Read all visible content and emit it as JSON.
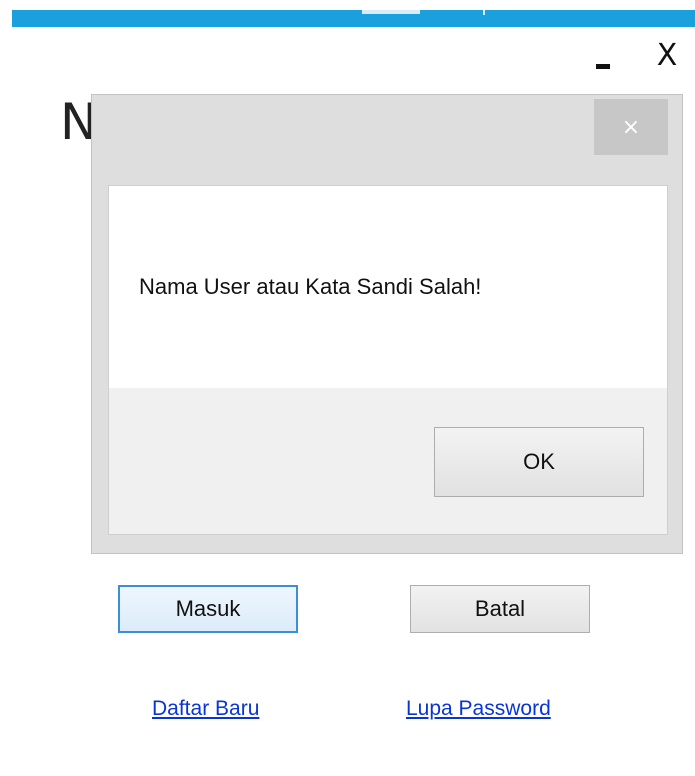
{
  "window": {
    "minimize_label": "_",
    "close_label": "X",
    "partial_title_glyph": "N",
    "accent_color": "#1aa0dd"
  },
  "main": {
    "masuk_label": "Masuk",
    "batal_label": "Batal",
    "daftar_baru_link": "Daftar Baru",
    "lupa_password_link": "Lupa Password"
  },
  "dialog": {
    "close_label": "×",
    "message": "Nama User atau Kata Sandi Salah!",
    "ok_label": "OK"
  },
  "icons": {
    "window_close": "close-icon",
    "window_minimize": "minimize-icon",
    "dialog_close": "close-icon"
  },
  "colors": {
    "link": "#0a35d6",
    "focus_border": "#3c8ed6",
    "dialog_close_bg": "#c7c7c7"
  }
}
